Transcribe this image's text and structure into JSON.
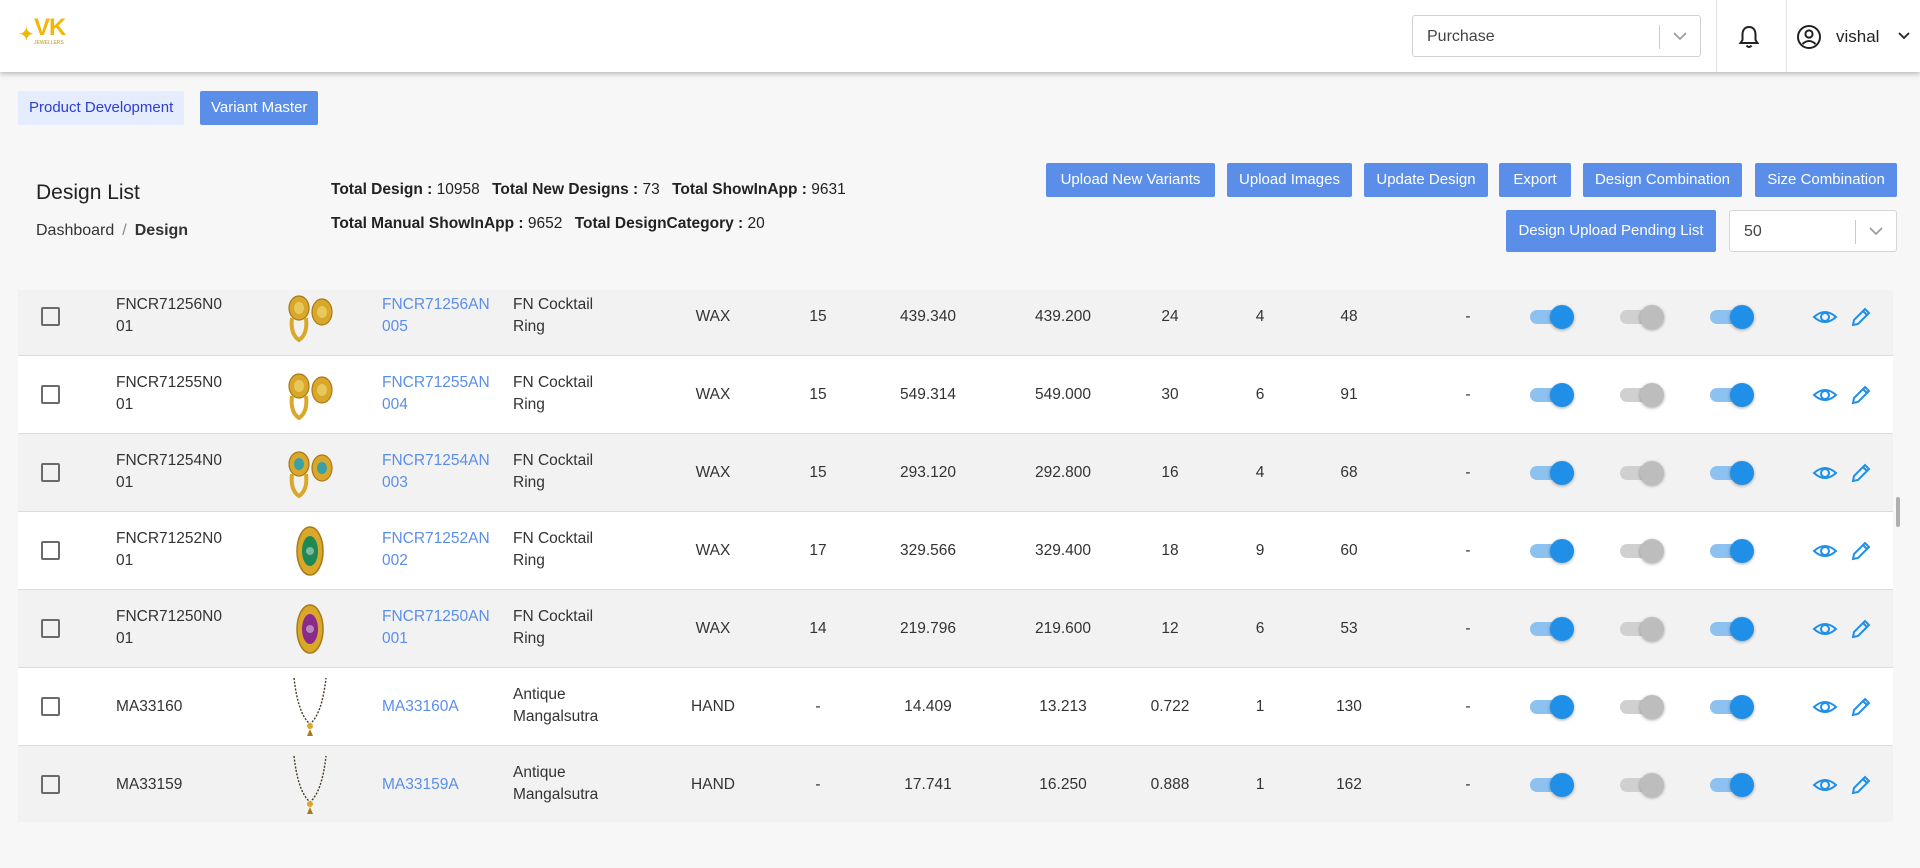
{
  "header": {
    "logo_text": "VK",
    "logo_sub": "JEWELLERS",
    "module_select": "Purchase",
    "user_name": "vishal"
  },
  "tabs": [
    {
      "label": "Product Development"
    },
    {
      "label": "Variant Master"
    }
  ],
  "page": {
    "title": "Design List",
    "breadcrumb": [
      "Dashboard",
      "Design"
    ]
  },
  "stats": {
    "total_design_label": "Total Design :",
    "total_design": "10958",
    "total_new_label": "Total New Designs :",
    "total_new": "73",
    "total_showinapp_label": "Total ShowInApp :",
    "total_showinapp": "9631",
    "total_manual_label": "Total Manual ShowInApp :",
    "total_manual": "9652",
    "total_category_label": "Total DesignCategory :",
    "total_category": "20"
  },
  "actions": [
    "Upload New Variants",
    "Upload Images",
    "Update Design",
    "Export",
    "Design Combination",
    "Size Combination",
    "Design Upload Pending List"
  ],
  "page_size": "50",
  "colors": {
    "accent": "#5b8ee8",
    "toggle_on": "#1f8fe8",
    "toggle_off": "#bdbdbd"
  },
  "rows": [
    {
      "design": [
        "FNCR71256N0",
        "01"
      ],
      "variant": [
        "FNCR71256AN",
        "005"
      ],
      "category": [
        "FN Cocktail",
        "Ring"
      ],
      "method": "WAX",
      "c1": "15",
      "c2": "439.340",
      "c3": "439.200",
      "c4": "24",
      "c5": "4",
      "c6": "48",
      "c7": "-",
      "t1": true,
      "t2": false,
      "t3": true,
      "image": "ring-pair"
    },
    {
      "design": [
        "FNCR71255N0",
        "01"
      ],
      "variant": [
        "FNCR71255AN",
        "004"
      ],
      "category": [
        "FN Cocktail",
        "Ring"
      ],
      "method": "WAX",
      "c1": "15",
      "c2": "549.314",
      "c3": "549.000",
      "c4": "30",
      "c5": "6",
      "c6": "91",
      "c7": "-",
      "t1": true,
      "t2": false,
      "t3": true,
      "image": "ring-pair"
    },
    {
      "design": [
        "FNCR71254N0",
        "01"
      ],
      "variant": [
        "FNCR71254AN",
        "003"
      ],
      "category": [
        "FN Cocktail",
        "Ring"
      ],
      "method": "WAX",
      "c1": "15",
      "c2": "293.120",
      "c3": "292.800",
      "c4": "16",
      "c5": "4",
      "c6": "68",
      "c7": "-",
      "t1": true,
      "t2": false,
      "t3": true,
      "image": "ring-pair-blue"
    },
    {
      "design": [
        "FNCR71252N0",
        "01"
      ],
      "variant": [
        "FNCR71252AN",
        "002"
      ],
      "category": [
        "FN Cocktail",
        "Ring"
      ],
      "method": "WAX",
      "c1": "17",
      "c2": "329.566",
      "c3": "329.400",
      "c4": "18",
      "c5": "9",
      "c6": "60",
      "c7": "-",
      "t1": true,
      "t2": false,
      "t3": true,
      "image": "ring-green"
    },
    {
      "design": [
        "FNCR71250N0",
        "01"
      ],
      "variant": [
        "FNCR71250AN",
        "001"
      ],
      "category": [
        "FN Cocktail",
        "Ring"
      ],
      "method": "WAX",
      "c1": "14",
      "c2": "219.796",
      "c3": "219.600",
      "c4": "12",
      "c5": "6",
      "c6": "53",
      "c7": "-",
      "t1": true,
      "t2": false,
      "t3": true,
      "image": "ring-purple"
    },
    {
      "design": [
        "MA33160",
        ""
      ],
      "variant": [
        "MA33160A",
        ""
      ],
      "category": [
        "Antique",
        "Mangalsutra"
      ],
      "method": "HAND",
      "c1": "-",
      "c2": "14.409",
      "c3": "13.213",
      "c4": "0.722",
      "c5": "1",
      "c6": "130",
      "c7": "-",
      "t1": true,
      "t2": false,
      "t3": true,
      "image": "mangalsutra"
    },
    {
      "design": [
        "MA33159",
        ""
      ],
      "variant": [
        "MA33159A",
        ""
      ],
      "category": [
        "Antique",
        "Mangalsutra"
      ],
      "method": "HAND",
      "c1": "-",
      "c2": "17.741",
      "c3": "16.250",
      "c4": "0.888",
      "c5": "1",
      "c6": "162",
      "c7": "-",
      "t1": true,
      "t2": false,
      "t3": true,
      "image": "mangalsutra"
    }
  ]
}
